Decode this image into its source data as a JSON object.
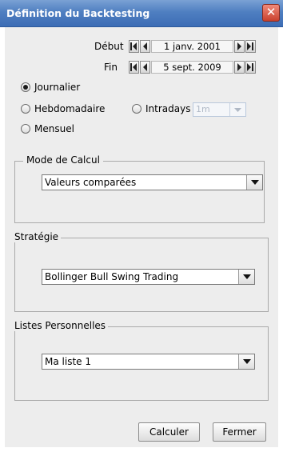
{
  "window": {
    "title": "Définition du Backtesting"
  },
  "dates": {
    "start_label": "Début",
    "start_value": "1 janv. 2001",
    "end_label": "Fin",
    "end_value": "5 sept. 2009"
  },
  "period": {
    "daily": "Journalier",
    "weekly": "Hebdomadaire",
    "intraday": "Intradays",
    "intraday_value": "1m",
    "monthly": "Mensuel",
    "selected": "daily"
  },
  "calc_mode": {
    "title": "Mode de Calcul",
    "value": "Valeurs comparées"
  },
  "strategy": {
    "title": "Stratégie",
    "value": "Bollinger Bull Swing Trading"
  },
  "lists": {
    "title": "Listes Personnelles",
    "value": "Ma liste 1"
  },
  "buttons": {
    "calculate": "Calculer",
    "close": "Fermer"
  }
}
